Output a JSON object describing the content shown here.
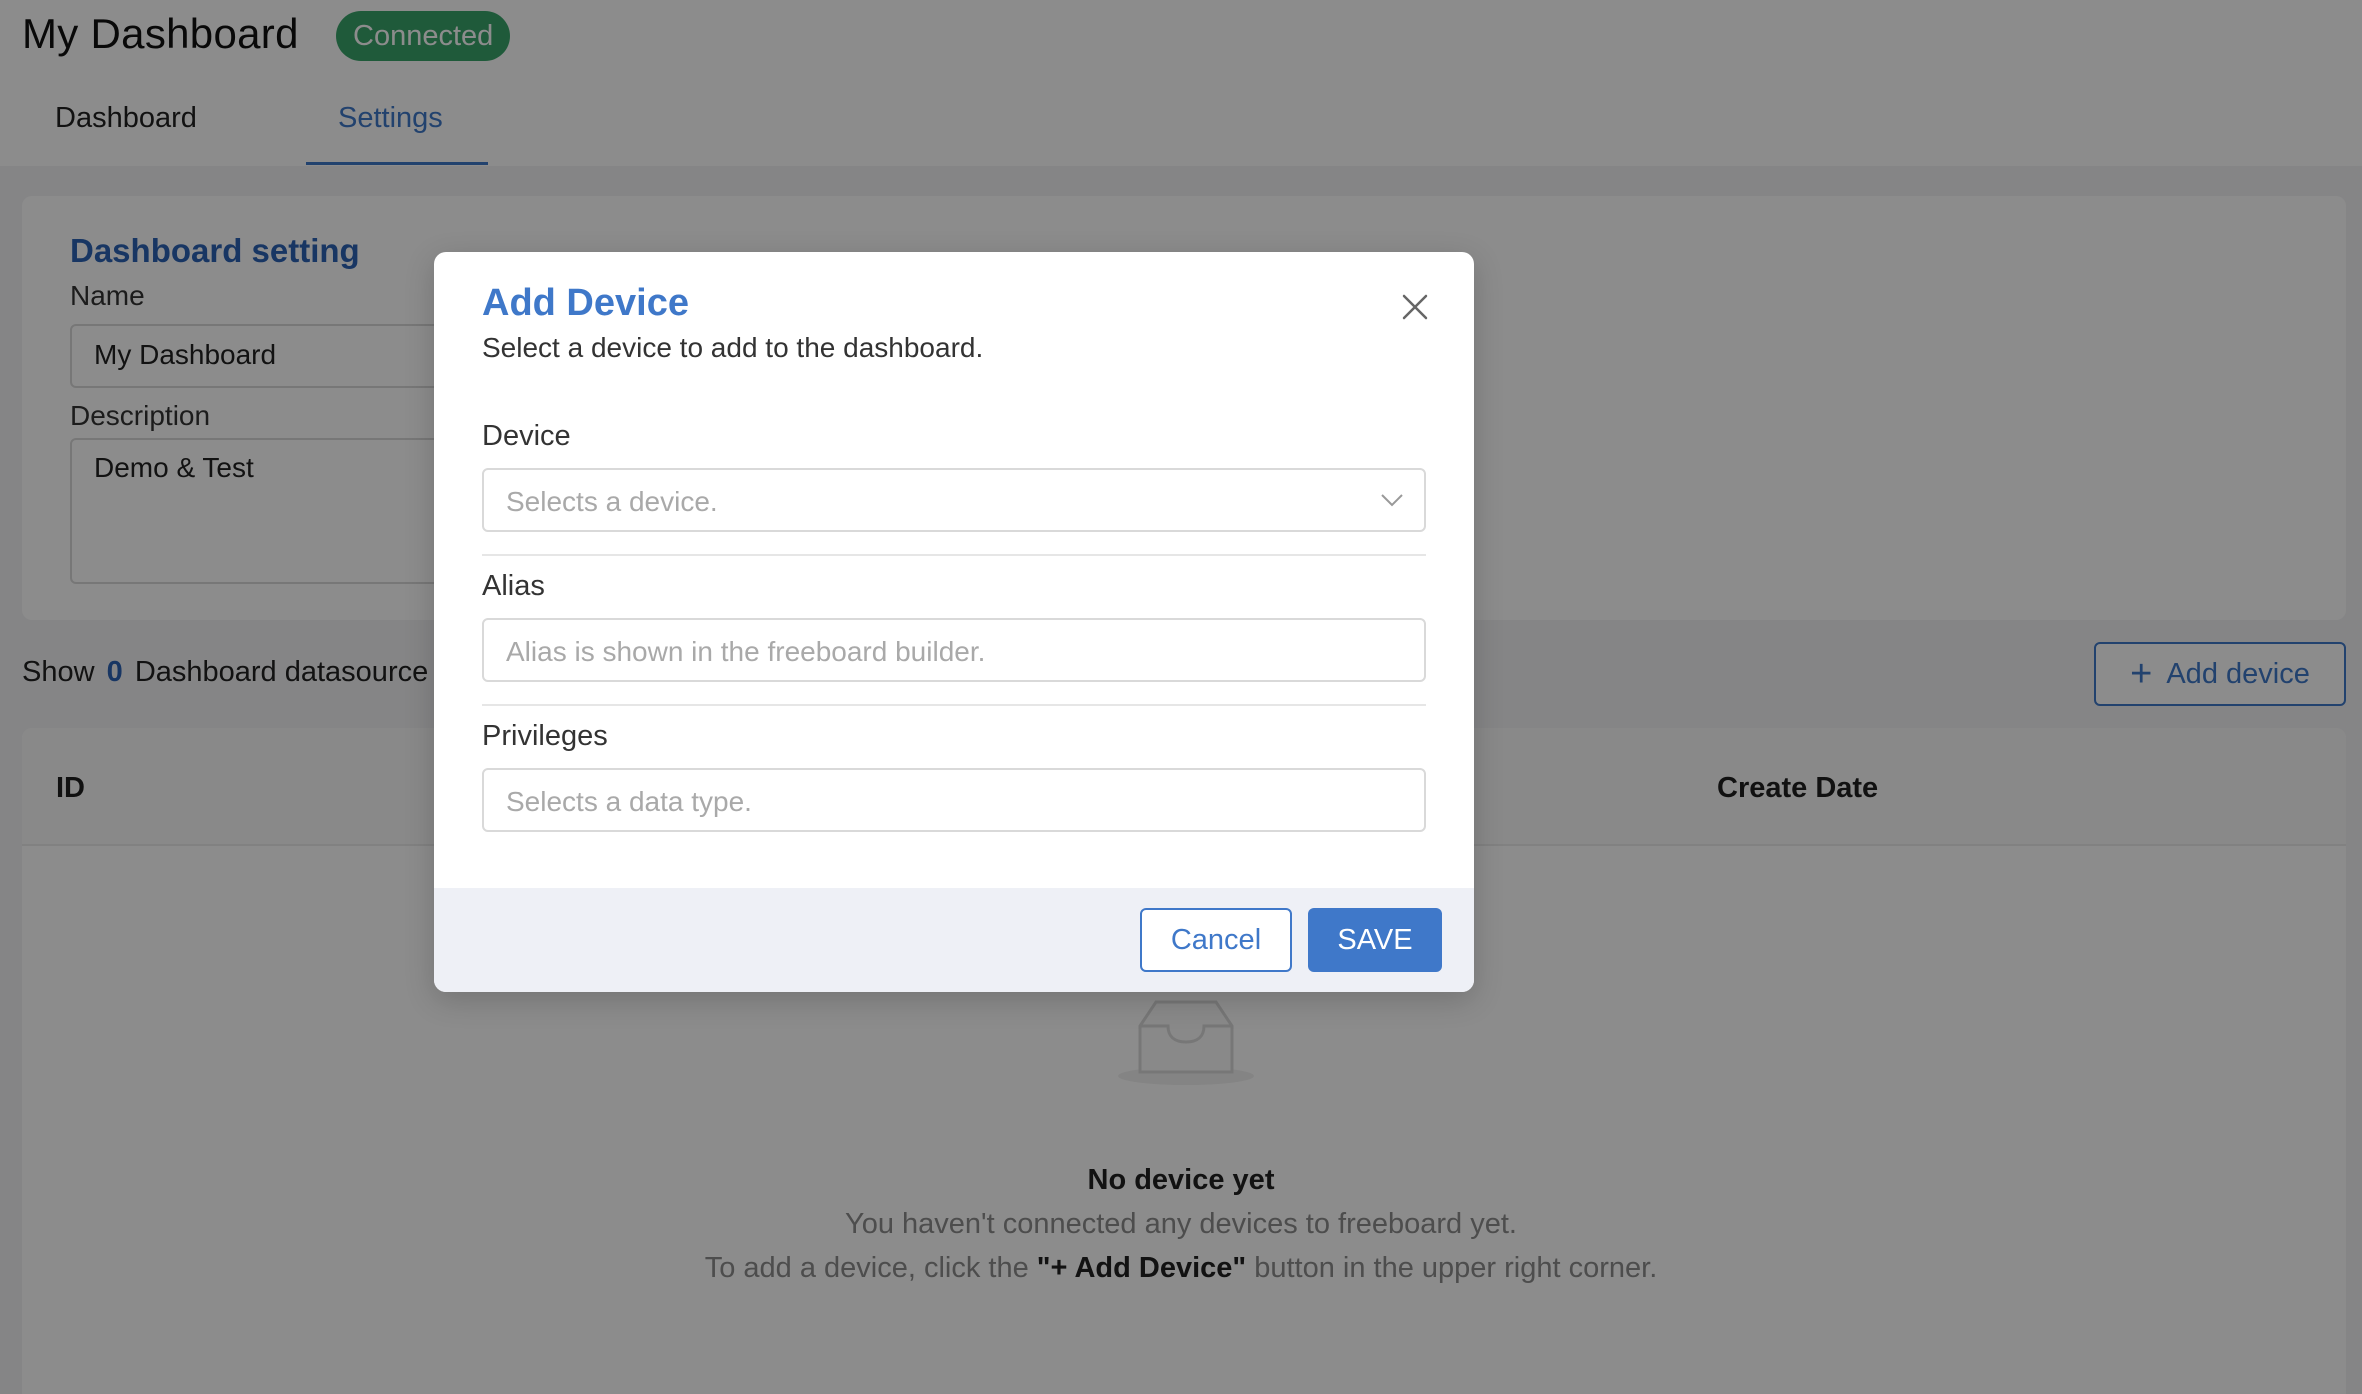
{
  "header": {
    "title": "My Dashboard",
    "status": "Connected",
    "tabs": [
      {
        "label": "Dashboard"
      },
      {
        "label": "Settings"
      }
    ],
    "active_tab": "Settings"
  },
  "settings": {
    "title": "Dashboard setting",
    "name_label": "Name",
    "name_value": "My Dashboard",
    "description_label": "Description",
    "description_value": "Demo & Test"
  },
  "datasource": {
    "prefix": "Show",
    "count": "0",
    "suffix": "Dashboard datasource",
    "add_button": "Add device"
  },
  "table": {
    "columns": [
      "ID",
      "Create Date"
    ],
    "empty_title": "No device yet",
    "empty_line1": "You haven't connected any devices to freeboard yet.",
    "empty_line2_before": "To add a device, click the",
    "empty_line2_bold": "\"+ Add Device\"",
    "empty_line2_after": "button in the upper right corner."
  },
  "modal": {
    "title": "Add Device",
    "subtitle": "Select a device to add to the dashboard.",
    "device_label": "Device",
    "device_placeholder": "Selects a device.",
    "alias_label": "Alias",
    "alias_placeholder": "Alias is shown in the freeboard builder.",
    "privileges_label": "Privileges",
    "privileges_placeholder": "Selects a data type.",
    "cancel_label": "Cancel",
    "save_label": "SAVE"
  },
  "colors": {
    "accent": "#3f78c9",
    "status": "#3aa56b",
    "footer": "#eef0f6"
  }
}
